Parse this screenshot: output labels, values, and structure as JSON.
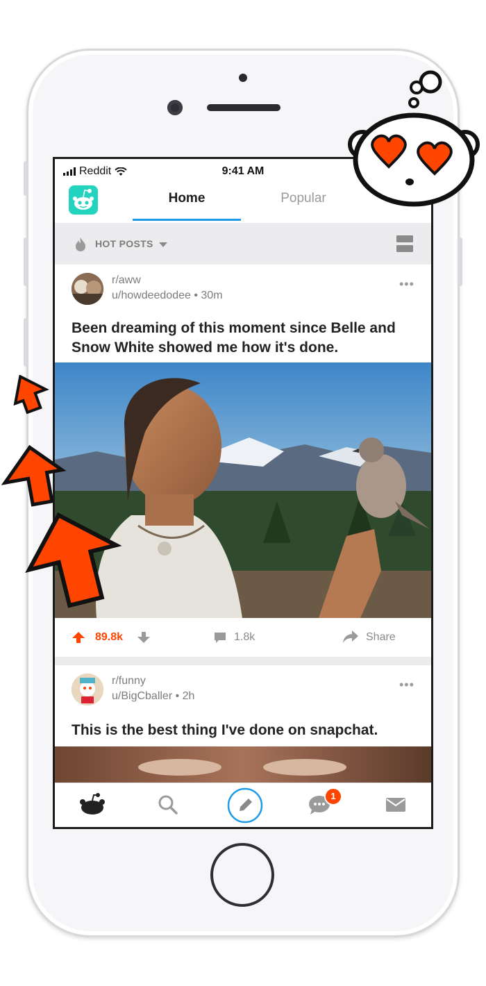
{
  "status": {
    "carrier": "Reddit",
    "time": "9:41 AM"
  },
  "nav": {
    "tabs": [
      {
        "label": "Home",
        "active": true
      },
      {
        "label": "Popular",
        "active": false
      }
    ]
  },
  "sort": {
    "label": "HOT POSTS"
  },
  "posts": [
    {
      "subreddit": "r/aww",
      "user": "u/howdeedodee",
      "age": "30m",
      "title": "Been dreaming of this moment since Belle and Snow White showed me how it's done.",
      "score": "89.8k",
      "comments": "1.8k",
      "share": "Share"
    },
    {
      "subreddit": "r/funny",
      "user": "u/BigCballer",
      "age": "2h",
      "title": "This is the best thing I've done on snapchat."
    }
  ],
  "bottom_nav": {
    "items": [
      "home-icon",
      "search-icon",
      "compose-icon",
      "chat-icon",
      "mail-icon"
    ],
    "chat_badge": "1"
  },
  "colors": {
    "upvote": "#ff4500",
    "accent": "#1d9be8",
    "logo_bg": "#24d3bd"
  }
}
